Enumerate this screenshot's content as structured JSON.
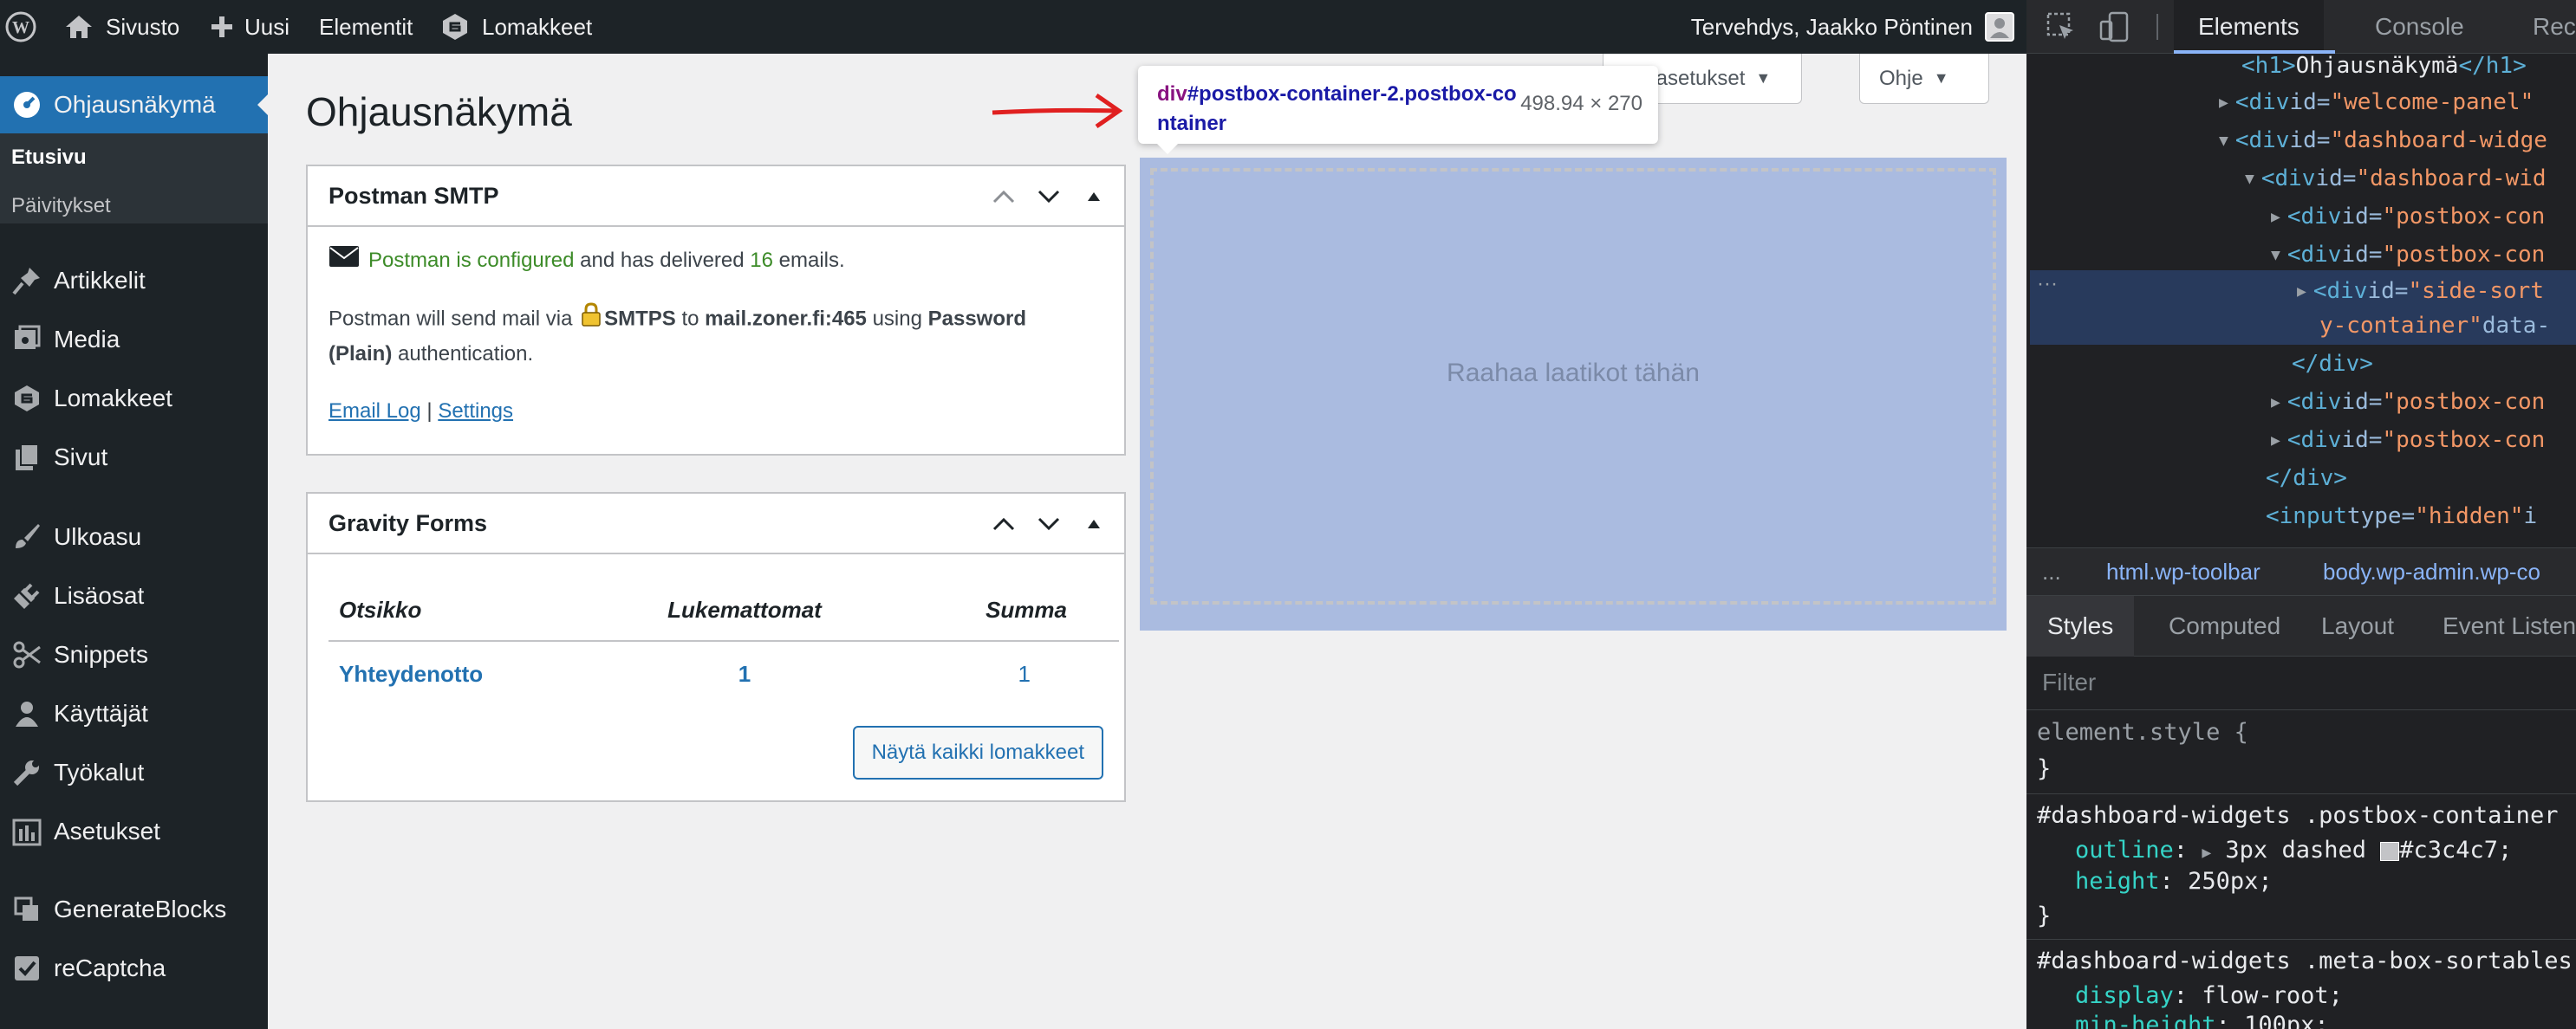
{
  "adminbar": {
    "site_label": "Sivusto",
    "new_label": "Uusi",
    "elements_label": "Elementit",
    "forms_label": "Lomakkeet",
    "greeting": "Tervehdys, Jaakko Pöntinen"
  },
  "sidebar": {
    "current": "Ohjausnäkymä",
    "submenu": [
      "Etusivu",
      "Päivitykset"
    ],
    "items": [
      "Artikkelit",
      "Media",
      "Lomakkeet",
      "Sivut",
      "Ulkoasu",
      "Lisäosat",
      "Snippets",
      "Käyttäjät",
      "Työkalut",
      "Asetukset",
      "GenerateBlocks",
      "reCaptcha"
    ]
  },
  "page": {
    "title": "Ohjausnäkymä",
    "screen_options": "yttöasetukset",
    "help": "Ohje"
  },
  "postman": {
    "title": "Postman SMTP",
    "configured": "Postman is configured",
    "delivered_pre": "and has delivered",
    "delivered_count": "16",
    "delivered_post": "emails.",
    "send_pre": "Postman will send mail via",
    "protocol": "SMTPS",
    "to": "to",
    "server": "mail.zoner.fi:465",
    "using": "using",
    "auth": "Password (Plain)",
    "auth_post": "authentication.",
    "email_log": "Email Log",
    "divider": "|",
    "settings": "Settings"
  },
  "gravity": {
    "title": "Gravity Forms",
    "headers": [
      "Otsikko",
      "Lukemattomat",
      "Summa"
    ],
    "rows": [
      [
        "Yhteydenotto",
        "1",
        "1"
      ]
    ],
    "view_all": "Näytä kaikki lomakkeet"
  },
  "dropzone": {
    "text": "Raahaa laatikot tähän"
  },
  "tooltip": {
    "selector_tag": "div",
    "selector_rest": "#postbox-container-2.postbox-container",
    "dimensions": "498.94 × 270"
  },
  "devtools": {
    "tabs": [
      "Elements",
      "Console",
      "Record"
    ],
    "dom": [
      {
        "pre": "<h1>",
        "text": "Ohjausnäkymä",
        "post": "</h1>"
      },
      {
        "tag": "<div ",
        "attr": "id=",
        "val": "\"welcome-panel\""
      },
      {
        "tag": "<div ",
        "attr": "id=",
        "val": "\"dashboard-widge"
      },
      {
        "tag": "<div ",
        "attr": "id=",
        "val": "\"dashboard-wid"
      },
      {
        "tag": "<div ",
        "attr": "id=",
        "val": "\"postbox-con"
      },
      {
        "tag": "<div ",
        "attr": "id=",
        "val": "\"postbox-con"
      },
      {
        "tag": "<div ",
        "attr": "id=",
        "val": "\"side-sort"
      },
      {
        "val2": "y-container\"",
        "attr2": " data-"
      },
      {
        "close": "</div>"
      },
      {
        "tag": "<div ",
        "attr": "id=",
        "val": "\"postbox-con"
      },
      {
        "tag": "<div ",
        "attr": "id=",
        "val": "\"postbox-con"
      },
      {
        "close": "</div>"
      },
      {
        "tag": "<input ",
        "attr": "type=",
        "val": "\"hidden\"",
        "extra": " i"
      }
    ],
    "breadcrumbs": [
      "...",
      "html.wp-toolbar",
      "body.wp-admin.wp-co"
    ],
    "style_tabs": [
      "Styles",
      "Computed",
      "Layout",
      "Event Listen"
    ],
    "filter": "Filter",
    "rules": {
      "element_style": "element.style {",
      "close": "}",
      "rule1_selector": "#dashboard-widgets .postbox-container",
      "rule1_outline_prop": "outline",
      "rule1_outline_val": "3px dashed",
      "rule1_outline_color": "#c3c4c7;",
      "rule1_height_prop": "height",
      "rule1_height_val": "250px;",
      "rule2_selector": "#dashboard-widgets .meta-box-sortables",
      "rule2_display_prop": "display",
      "rule2_display_val": "flow-root;",
      "rule2_minh_prop": "min-height",
      "rule2_minh_val": "100px;"
    }
  },
  "colors": {
    "admin_bg": "#1d2327",
    "accent": "#2271b1",
    "dropzone": "#aabbe0",
    "devtools_bg": "#202124"
  }
}
